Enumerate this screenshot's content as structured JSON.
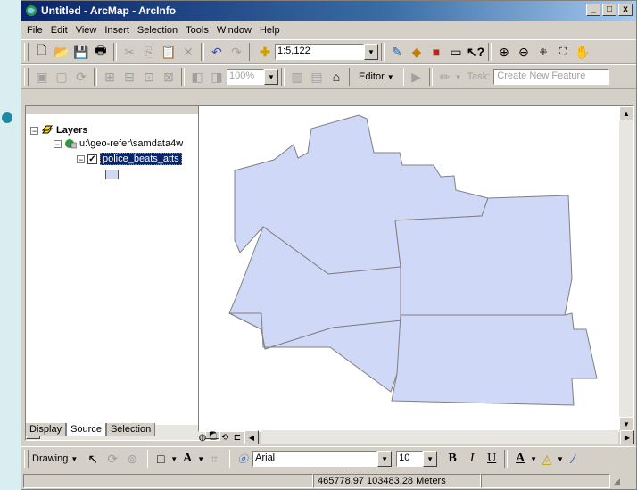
{
  "window": {
    "title": "Untitled - ArcMap - ArcInfo",
    "min": "_",
    "max": "□",
    "close": "x"
  },
  "menu": [
    "File",
    "Edit",
    "View",
    "Insert",
    "Selection",
    "Tools",
    "Window",
    "Help"
  ],
  "standard_toolbar": {
    "scale": "1:5,122"
  },
  "editor_toolbar": {
    "zoom_percent": "100%",
    "editor_label": "Editor",
    "task_label": "Task:",
    "task_value": "Create New Feature"
  },
  "toc": {
    "layers_label": "Layers",
    "source_path": "u:\\geo-refer\\samdata4w",
    "layer_name": "police_beats_atts",
    "tabs": [
      "Display",
      "Source",
      "Selection"
    ],
    "active_tab": "Source",
    "checked": "✓",
    "expand": "−"
  },
  "drawing_toolbar": {
    "drawing_label": "Drawing",
    "font_name": "Arial",
    "font_size": "10",
    "bold": "B",
    "italic": "I",
    "underline": "U",
    "font_color": "A"
  },
  "status_bar": {
    "coordinates": "465778.97  103483.28 Meters"
  },
  "colors": {
    "polygon_fill": "#d0d8f8",
    "polygon_outline": "#808080",
    "selection": "#0a246a",
    "title_start": "#0a246a"
  }
}
